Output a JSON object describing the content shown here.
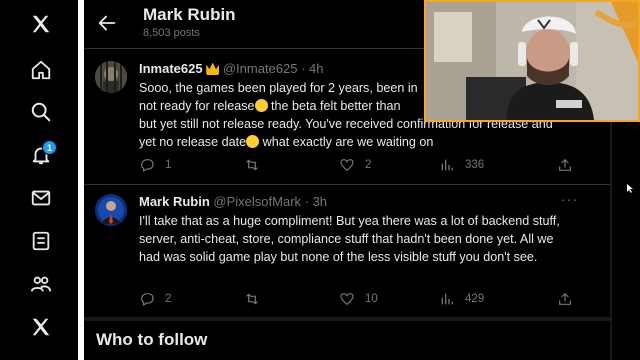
{
  "header": {
    "title": "Mark Rubin",
    "subtitle": "8,503 posts"
  },
  "sidebar": {
    "notification_count": "1"
  },
  "tweets": [
    {
      "name": "Inmate625",
      "handle": "@Inmate625 · 4h",
      "line1": "Sooo, the games been played for 2 years, been in",
      "line2a": "not ready for release",
      "line2b": " the beta felt better than",
      "line3": "but yet still not release ready. You've received confirmation for release and",
      "line4a": "yet no release date",
      "line4b": " what exactly are we waiting on",
      "replies": "1",
      "reposts": "",
      "likes": "2",
      "views": "336"
    },
    {
      "name": "Mark Rubin",
      "handle": "@PixelsofMark · 3h",
      "text": "I'll take that as a huge compliment! But yea there was a lot of backend stuff, server, anti-cheat, store, compliance stuff that hadn't been done yet. All we had was solid game play but none of the less visible stuff you don't see.",
      "replies": "2",
      "reposts": "",
      "likes": "10",
      "views": "429"
    }
  ],
  "who_to_follow": "Who to follow",
  "colors": {
    "background": "#000000",
    "text": "#e7e9ea",
    "muted": "#71767b",
    "accent": "#1d9bf0",
    "webcam_border": "#f5a623"
  }
}
